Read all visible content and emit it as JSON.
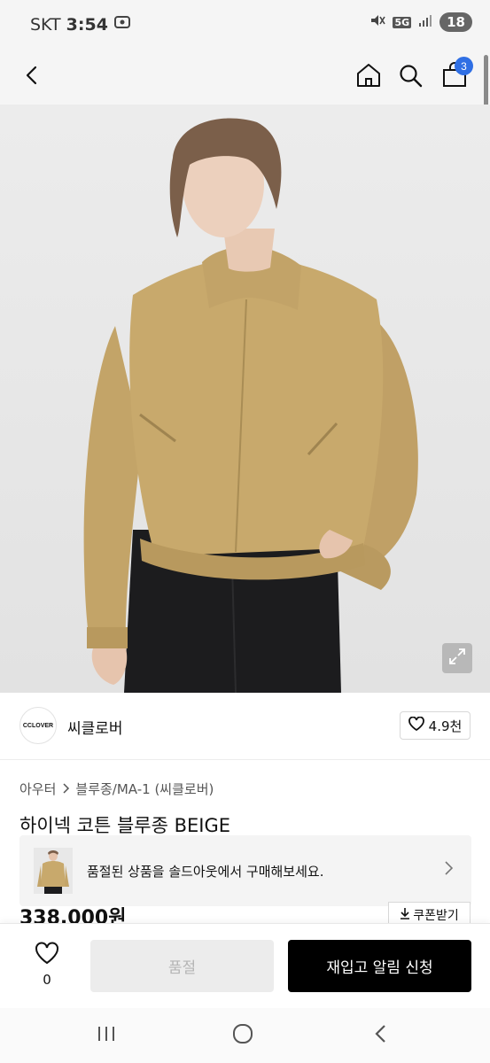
{
  "status_bar": {
    "carrier": "SKT",
    "time": "3:54",
    "network": "5G",
    "battery": "18"
  },
  "header": {
    "back_icon": "chevron-left-icon",
    "home_icon": "home-icon",
    "search_icon": "search-icon",
    "cart_icon": "shopping-bag-icon",
    "cart_count": "3",
    "badge_color": "#2f6fe4"
  },
  "hero": {
    "expand_icon": "expand-icon"
  },
  "brand": {
    "logo_text": "CCLOVER",
    "name": "씨클로버",
    "rating": "4.9천"
  },
  "breadcrumb": {
    "category": "아우터",
    "subcategory": "블루종/MA-1 (씨클로버)"
  },
  "product": {
    "title": "하이넥 코튼 블루종 BEIGE",
    "price": "338,000원",
    "coupon_label": "쿠폰받기"
  },
  "soldout_banner": {
    "text": "품절된 상품을 솔드아웃에서 구매해보세요."
  },
  "actions": {
    "wish_count": "0",
    "soldout_label": "품절",
    "restock_label": "재입고 알림 신청"
  },
  "colors": {
    "accent": "#000000",
    "jacket": "#c8a96c"
  }
}
